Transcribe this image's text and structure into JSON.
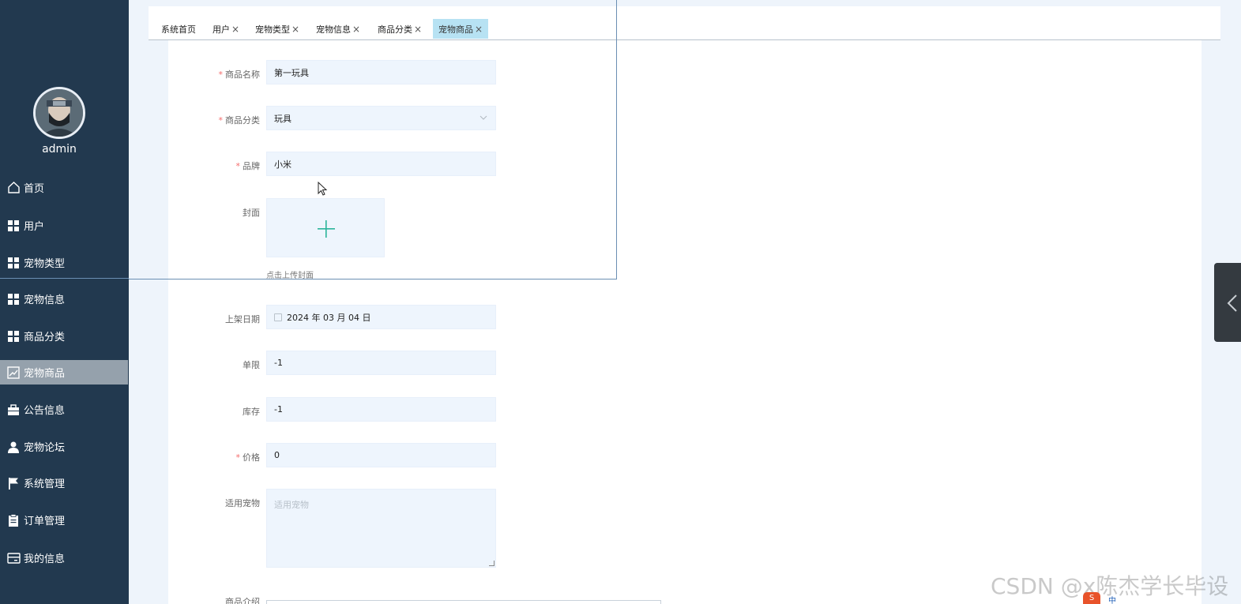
{
  "sidebar": {
    "username": "admin",
    "items": [
      {
        "label": "首页",
        "icon": "home-icon"
      },
      {
        "label": "用户",
        "icon": "grid-icon"
      },
      {
        "label": "宠物类型",
        "icon": "grid-icon"
      },
      {
        "label": "宠物信息",
        "icon": "grid-icon"
      },
      {
        "label": "商品分类",
        "icon": "grid-icon"
      },
      {
        "label": "宠物商品",
        "icon": "chart-icon",
        "active": true
      },
      {
        "label": "公告信息",
        "icon": "briefcase-icon"
      },
      {
        "label": "宠物论坛",
        "icon": "user-icon"
      },
      {
        "label": "系统管理",
        "icon": "flag-icon"
      },
      {
        "label": "订单管理",
        "icon": "clipboard-icon"
      },
      {
        "label": "我的信息",
        "icon": "card-icon"
      }
    ]
  },
  "tabs": [
    {
      "label": "系统首页",
      "closable": false
    },
    {
      "label": "用户",
      "closable": true
    },
    {
      "label": "宠物类型",
      "closable": true
    },
    {
      "label": "宠物信息",
      "closable": true
    },
    {
      "label": "商品分类",
      "closable": true
    },
    {
      "label": "宠物商品",
      "closable": true,
      "active": true
    }
  ],
  "tab_close_glyph": "×",
  "form": {
    "name": {
      "label": "商品名称",
      "required": true,
      "value": "第一玩具"
    },
    "category": {
      "label": "商品分类",
      "required": true,
      "value": "玩具"
    },
    "brand": {
      "label": "品牌",
      "required": true,
      "value": "小米"
    },
    "cover": {
      "label": "封面",
      "hint": "点击上传封面"
    },
    "date": {
      "label": "上架日期",
      "value": "2024 年 03 月 04 日"
    },
    "limit": {
      "label": "单限",
      "value": "-1"
    },
    "stock": {
      "label": "库存",
      "value": "-1"
    },
    "price": {
      "label": "价格",
      "required": true,
      "value": "0"
    },
    "suitable": {
      "label": "适用宠物",
      "placeholder": "适用宠物"
    },
    "intro": {
      "label": "商品介绍"
    }
  },
  "required_mark": "*",
  "watermark": "CSDN @x陈杰学长毕设",
  "tray": {
    "logo": "S",
    "input_method": "中"
  },
  "colors": {
    "sidebar_bg": "#22394f",
    "active_menu_bg": "#95a1ac",
    "active_tab_bg": "#b7e2f3",
    "input_bg": "#eef5fd",
    "plus_color": "#2bb49a",
    "required": "#f56c6c"
  }
}
